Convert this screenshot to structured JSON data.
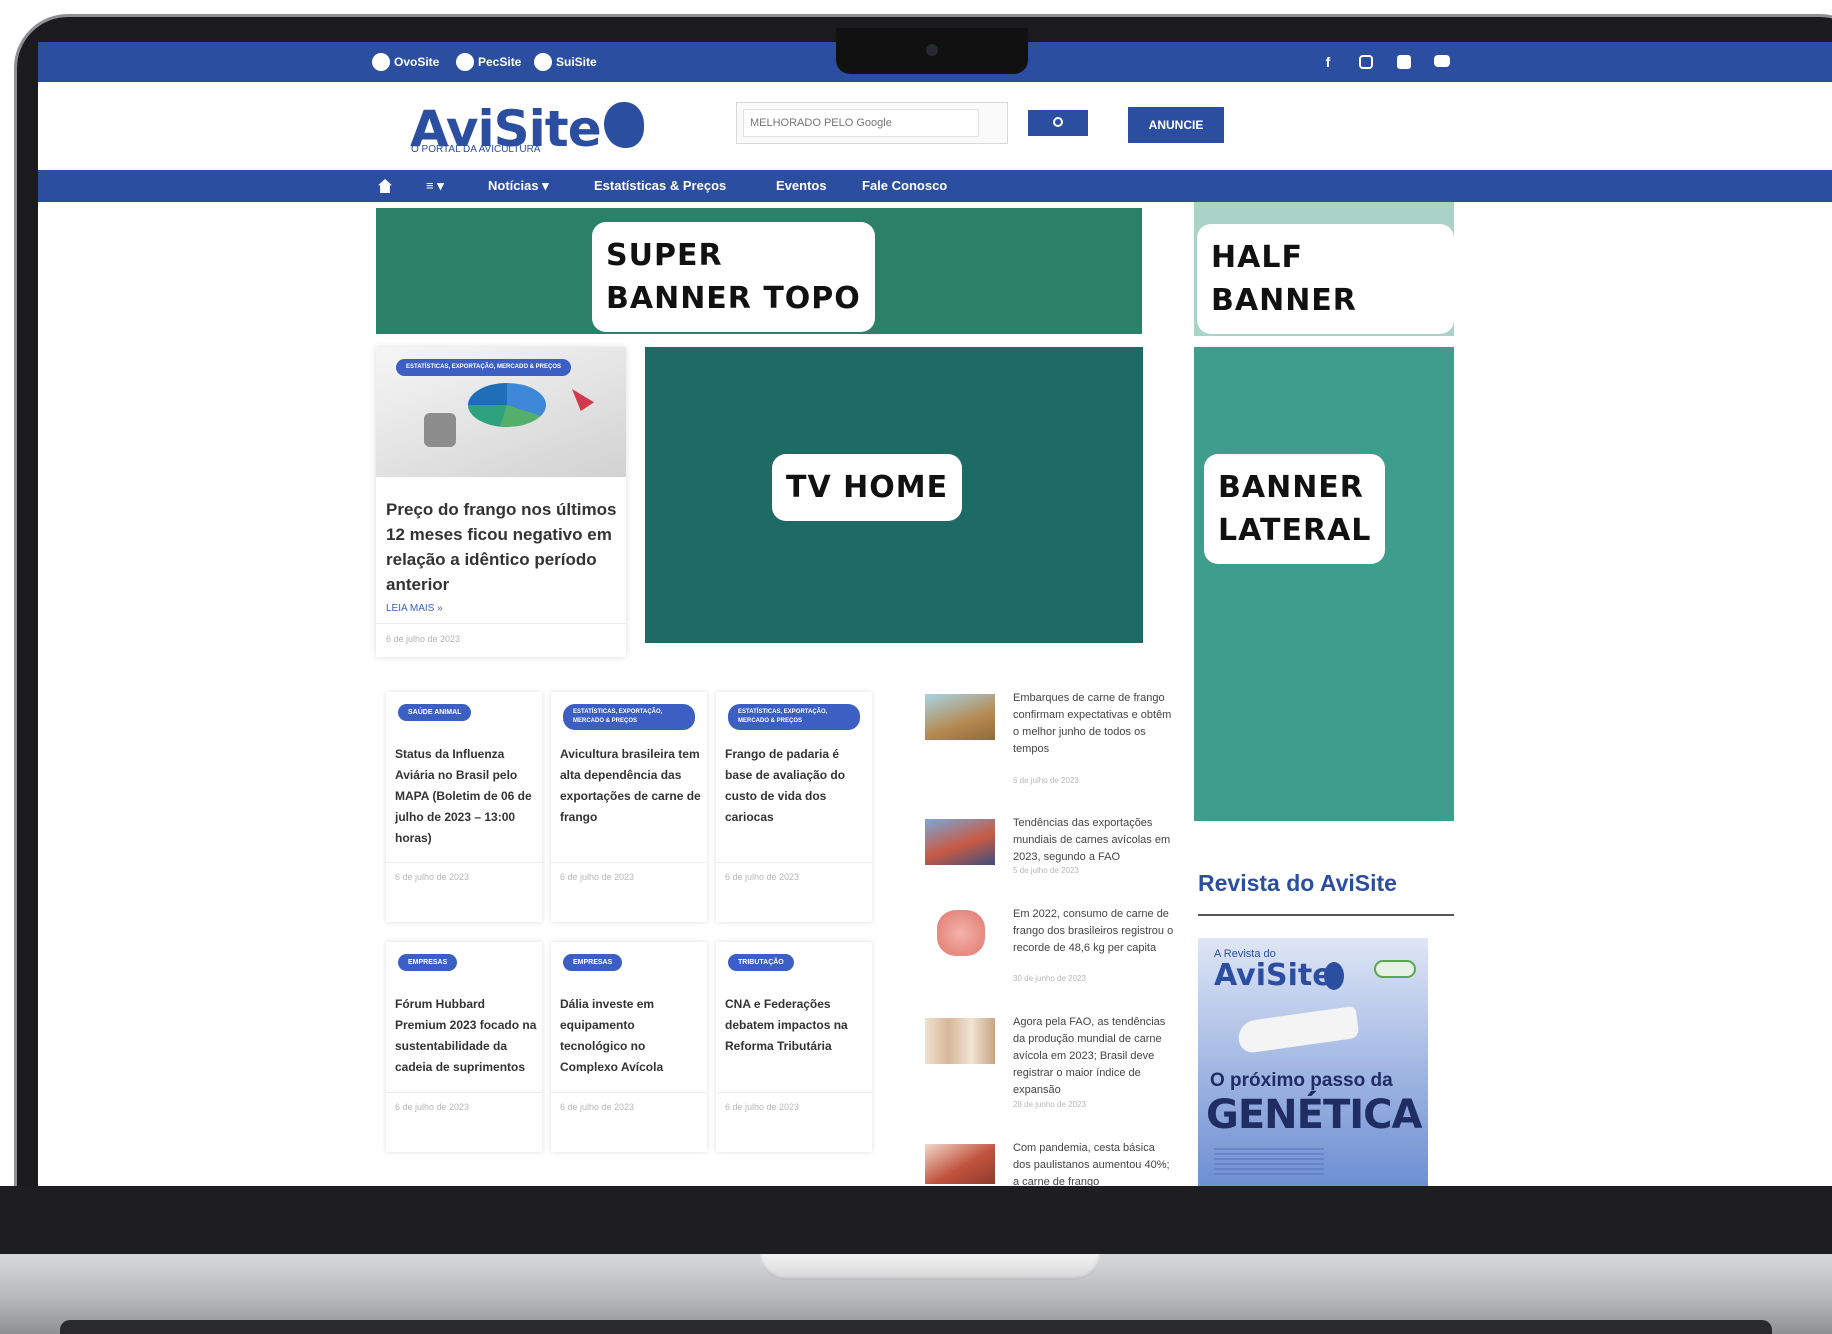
{
  "topbar": {
    "sites": [
      {
        "label": "OvoSite",
        "icon": "eggs-icon"
      },
      {
        "label": "PecSite",
        "icon": "cow-icon"
      },
      {
        "label": "SuiSite",
        "icon": "pig-icon"
      }
    ],
    "social": [
      "facebook-icon",
      "instagram-icon",
      "linkedin-icon",
      "youtube-icon"
    ],
    "social_glyphs": {
      "facebook": "f"
    }
  },
  "header": {
    "logo_text": "AviSite",
    "tagline": "O PORTAL DA AVICULTURA",
    "search_placeholder": "MELHORADO PELO Google",
    "anuncie_label": "ANUNCIE"
  },
  "nav": {
    "items": [
      "Notícias ▾",
      "Estatísticas & Preços",
      "Eventos",
      "Fale Conosco"
    ],
    "menu_label": "≡ ▾"
  },
  "banners": {
    "super_banner": "SUPER\nBANNER TOPO",
    "half_banner": "HALF BANNER",
    "tv_home": "TV HOME",
    "banner_lateral": "BANNER\nLATERAL"
  },
  "featured": {
    "tag": "ESTATÍSTICAS, EXPORTAÇÃO, MERCADO & PREÇOS",
    "title": "Preço do frango nos últimos 12 meses ficou negativo em relação a idêntico período anterior",
    "read_more": "LEIA MAIS »",
    "date": "6 de julho de 2023"
  },
  "grid_cards": [
    {
      "tag": "SAÚDE ANIMAL",
      "title": "Status da Influenza Aviária no Brasil pelo MAPA (Boletim de 06 de julho de 2023 – 13:00 horas)",
      "date": "6 de julho de 2023"
    },
    {
      "tag": "ESTATÍSTICAS, EXPORTAÇÃO, MERCADO & PREÇOS",
      "title": "Avicultura brasileira tem alta dependência das exportações de carne de frango",
      "date": "6 de julho de 2023"
    },
    {
      "tag": "ESTATÍSTICAS, EXPORTAÇÃO, MERCADO & PREÇOS",
      "title": "Frango de padaria é base de avaliação do custo de vida dos cariocas",
      "date": "6 de julho de 2023"
    },
    {
      "tag": "EMPRESAS",
      "title": "Fórum Hubbard Premium 2023 focado na sustentabilidade da cadeia de suprimentos",
      "date": "6 de julho de 2023"
    },
    {
      "tag": "EMPRESAS",
      "title": "Dália investe em equipamento tecnológico no Complexo Avícola",
      "date": "6 de julho de 2023"
    },
    {
      "tag": "TRIBUTAÇÃO",
      "title": "CNA e Federações debatem impactos na Reforma Tributária",
      "date": "6 de julho de 2023"
    }
  ],
  "side_news": [
    {
      "title": "Embarques de carne de frango confirmam expectativas e obtêm o melhor junho de todos os tempos",
      "date": "6 de julho de 2023",
      "thumb_color": "#b58a52"
    },
    {
      "title": "Tendências das exportações mundiais de carnes avícolas em 2023, segundo a FAO",
      "date": "5 de julho de 2023",
      "thumb_color": "#c85a43"
    },
    {
      "title": "Em 2022, consumo de carne de frango dos brasileiros registrou o recorde de 48,6 kg per capita",
      "date": "30 de junho de 2023",
      "thumb_color": "#e58c82"
    },
    {
      "title": "Agora pela FAO, as tendências da produção mundial de carne avícola em 2023; Brasil deve registrar o maior índice de expansão",
      "date": "28 de junho de 2023",
      "thumb_color": "#d9b79a"
    },
    {
      "title": "Com pandemia, cesta básica dos paulistanos aumentou 40%; a carne de frango",
      "date": "",
      "thumb_color": "#c1533e"
    }
  ],
  "magazine": {
    "heading": "Revista do AviSite",
    "cover_kicker": "A Revista do",
    "cover_logo": "AviSite",
    "cover_headline": "O próximo passo da",
    "cover_big": "GENÉTICA"
  },
  "colors": {
    "brand_blue": "#2c4ea0",
    "super_banner": "#2a8168",
    "half_banner": "#aad3c8",
    "tv_home": "#1e6a64",
    "banner_lateral": "#3e9d8c"
  }
}
